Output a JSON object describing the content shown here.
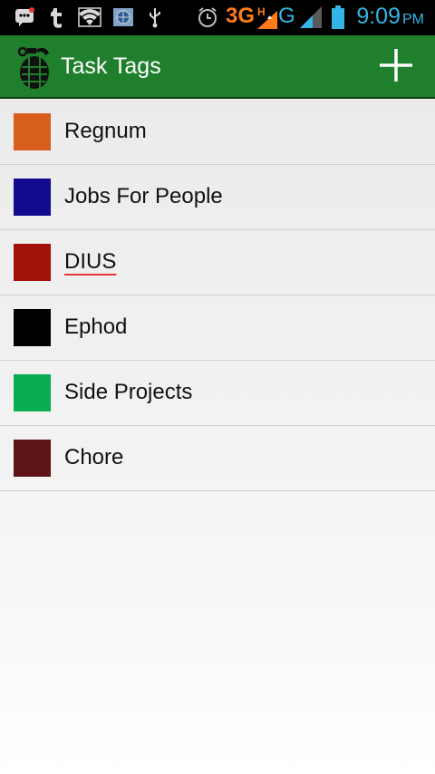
{
  "status_bar": {
    "network_primary": "3G",
    "network_secondary": "G",
    "time": "9:09",
    "ampm": "PM",
    "icons": [
      "bbm-icon",
      "tumblr-icon",
      "wifi-icon",
      "globe-icon",
      "usb-icon",
      "alarm-icon",
      "signal-icon",
      "battery-icon"
    ]
  },
  "action_bar": {
    "title": "Task Tags",
    "logo_icon": "grenade-icon",
    "add_icon": "plus-icon"
  },
  "tags": [
    {
      "label": "Regnum",
      "color": "#d95f1e"
    },
    {
      "label": "Jobs For People",
      "color": "#120a8f"
    },
    {
      "label": "DIUS",
      "color": "#a11309"
    },
    {
      "label": "Ephod",
      "color": "#000000"
    },
    {
      "label": "Side Projects",
      "color": "#0aae52"
    },
    {
      "label": "Chore",
      "color": "#5e1416"
    }
  ],
  "colors": {
    "action_bar": "#1f7f2d",
    "status_accent": "#33b5e5",
    "network_accent": "#ff7a1a"
  }
}
